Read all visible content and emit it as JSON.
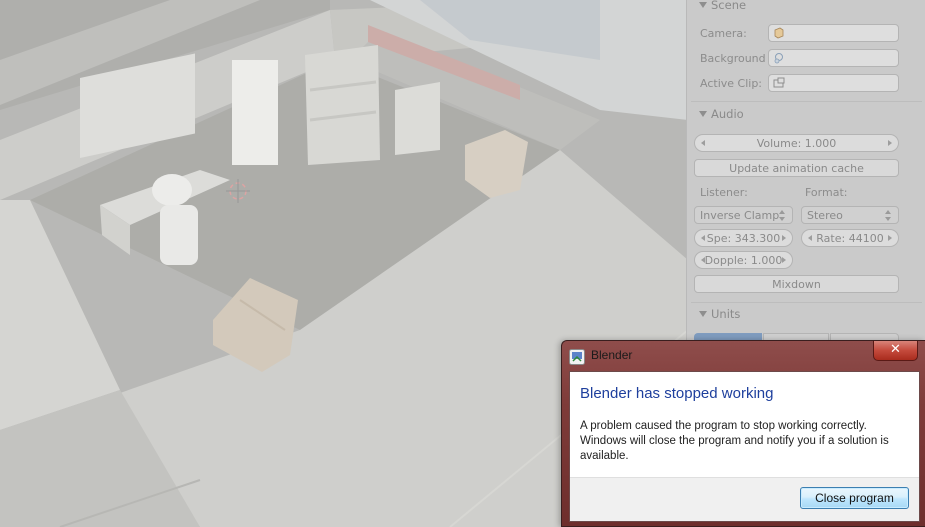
{
  "scene_panel": {
    "title": "Scene",
    "camera_label": "Camera:",
    "background_label": "Background",
    "active_clip_label": "Active Clip:"
  },
  "audio_panel": {
    "title": "Audio",
    "volume": "Volume: 1.000",
    "update_cache": "Update animation cache",
    "listener_label": "Listener:",
    "format_label": "Format:",
    "listener_value": "Inverse Clamp",
    "format_value": "Stereo",
    "speed": "Spe: 343.300",
    "rate": "Rate: 44100",
    "doppler": "Dopple: 1.000",
    "mixdown": "Mixdown"
  },
  "units_panel": {
    "title": "Units"
  },
  "dialog": {
    "title": "Blender",
    "close_glyph": "✕",
    "heading": "Blender has stopped working",
    "message": "A problem caused the program to stop working correctly. Windows will close the program and notify you if a solution is available.",
    "close_program": "Close program"
  },
  "icons": [
    "camera-icon",
    "world-icon",
    "clip-icon",
    "blender-icon",
    "close-icon"
  ]
}
